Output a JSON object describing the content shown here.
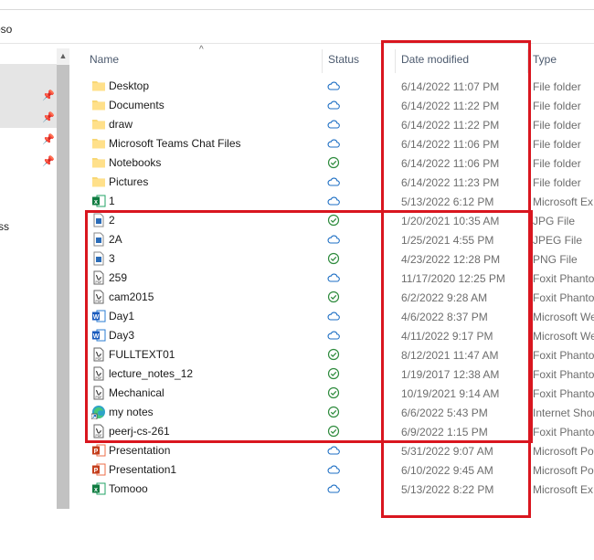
{
  "address": {
    "text": "oso"
  },
  "sidebar": {
    "partial_label": "ss"
  },
  "columns": {
    "name": "Name",
    "status": "Status",
    "date": "Date modified",
    "type": "Type"
  },
  "files": [
    {
      "name": "Desktop",
      "icon": "folder-icon",
      "status": "cloud",
      "date": "6/14/2022 11:07 PM",
      "type": "File folder"
    },
    {
      "name": "Documents",
      "icon": "folder-icon",
      "status": "cloud",
      "date": "6/14/2022 11:22 PM",
      "type": "File folder"
    },
    {
      "name": "draw",
      "icon": "folder-icon",
      "status": "cloud",
      "date": "6/14/2022 11:22 PM",
      "type": "File folder"
    },
    {
      "name": "Microsoft Teams Chat Files",
      "icon": "folder-icon",
      "status": "cloud",
      "date": "6/14/2022 11:06 PM",
      "type": "File folder"
    },
    {
      "name": "Notebooks",
      "icon": "folder-icon",
      "status": "check",
      "date": "6/14/2022 11:06 PM",
      "type": "File folder"
    },
    {
      "name": "Pictures",
      "icon": "folder-icon",
      "status": "cloud",
      "date": "6/14/2022 11:23 PM",
      "type": "File folder"
    },
    {
      "name": "1",
      "icon": "excel-icon",
      "status": "cloud",
      "date": "5/13/2022 6:12 PM",
      "type": "Microsoft Ex"
    },
    {
      "name": "2",
      "icon": "image-icon",
      "status": "check",
      "date": "1/20/2021 10:35 AM",
      "type": "JPG File"
    },
    {
      "name": "2A",
      "icon": "image-icon",
      "status": "cloud",
      "date": "1/25/2021 4:55 PM",
      "type": "JPEG File"
    },
    {
      "name": "3",
      "icon": "image-icon",
      "status": "check",
      "date": "4/23/2022 12:28 PM",
      "type": "PNG File"
    },
    {
      "name": "259",
      "icon": "pdf-icon",
      "status": "cloud",
      "date": "11/17/2020 12:25 PM",
      "type": "Foxit Phanto"
    },
    {
      "name": "cam2015",
      "icon": "pdf-icon",
      "status": "check",
      "date": "6/2/2022 9:28 AM",
      "type": "Foxit Phanto"
    },
    {
      "name": "Day1",
      "icon": "word-icon",
      "status": "cloud",
      "date": "4/6/2022 8:37 PM",
      "type": "Microsoft We"
    },
    {
      "name": "Day3",
      "icon": "word-icon",
      "status": "cloud",
      "date": "4/11/2022 9:17 PM",
      "type": "Microsoft We"
    },
    {
      "name": "FULLTEXT01",
      "icon": "pdf-icon",
      "status": "check",
      "date": "8/12/2021 11:47 AM",
      "type": "Foxit Phanto"
    },
    {
      "name": "lecture_notes_12",
      "icon": "pdf-icon",
      "status": "check",
      "date": "1/19/2017 12:38 AM",
      "type": "Foxit Phanto"
    },
    {
      "name": "Mechanical",
      "icon": "pdf-icon",
      "status": "check",
      "date": "10/19/2021 9:14 AM",
      "type": "Foxit Phanto"
    },
    {
      "name": "my notes",
      "icon": "edge-shortcut-icon",
      "status": "check",
      "date": "6/6/2022 5:43 PM",
      "type": "Internet Shor"
    },
    {
      "name": "peerj-cs-261",
      "icon": "pdf-icon",
      "status": "check",
      "date": "6/9/2022 1:15 PM",
      "type": "Foxit Phanto"
    },
    {
      "name": "Presentation",
      "icon": "powerpoint-icon",
      "status": "cloud",
      "date": "5/31/2022 9:07 AM",
      "type": "Microsoft Po"
    },
    {
      "name": "Presentation1",
      "icon": "powerpoint-icon",
      "status": "cloud",
      "date": "6/10/2022 9:45 AM",
      "type": "Microsoft Po"
    },
    {
      "name": "Tomooo",
      "icon": "excel-icon",
      "status": "cloud",
      "date": "5/13/2022 8:22 PM",
      "type": "Microsoft Ex"
    }
  ],
  "colors": {
    "highlight_box": "#d9161f",
    "cloud": "#1e6fc4",
    "check": "#2e8b3d"
  }
}
